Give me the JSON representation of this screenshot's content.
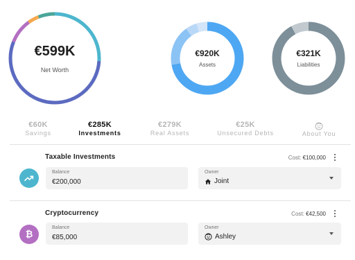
{
  "summary": {
    "net_worth": {
      "value": "€599K",
      "label": "Net Worth",
      "segments": [
        {
          "color": "#4db6ce",
          "fraction": 0.26
        },
        {
          "color": "#5c6bc0",
          "fraction": 0.55
        },
        {
          "color": "#b36fc2",
          "fraction": 0.09
        },
        {
          "color": "#f4a950",
          "fraction": 0.04
        },
        {
          "color": "#4aa59a",
          "fraction": 0.06
        }
      ]
    },
    "assets": {
      "value": "€920K",
      "label": "Assets",
      "segments": [
        {
          "color": "#4ea7f2",
          "fraction": 0.72
        },
        {
          "color": "#8cc3f5",
          "fraction": 0.18
        },
        {
          "color": "#b9d8f7",
          "fraction": 0.05
        },
        {
          "color": "#d3e5f8",
          "fraction": 0.05
        }
      ]
    },
    "liabilities": {
      "value": "€321K",
      "label": "Liabilities",
      "segments": [
        {
          "color": "#7d8f99",
          "fraction": 0.92
        },
        {
          "color": "#c2cacf",
          "fraction": 0.08
        }
      ]
    }
  },
  "tabs": [
    {
      "value": "€60K",
      "label": "Savings",
      "active": false
    },
    {
      "value": "€285K",
      "label": "Investments",
      "active": true
    },
    {
      "value": "€279K",
      "label": "Real Assets",
      "active": false
    },
    {
      "value": "€25K",
      "label": "Unsecured Debts",
      "active": false
    },
    {
      "value": "",
      "label": "About You",
      "icon": "face-icon",
      "active": false
    }
  ],
  "accounts": [
    {
      "title": "Taxable Investments",
      "cost_label": "Cost:",
      "cost_value": "€100,000",
      "icon": "investment-growth-icon",
      "icon_color": "#4db6ce",
      "balance_label": "Balance",
      "balance_value": "€200,000",
      "owner_label": "Owner",
      "owner_value": "Joint",
      "owner_icon": "home-icon"
    },
    {
      "title": "Cryptocurrency",
      "cost_label": "Cost:",
      "cost_value": "€42,500",
      "icon": "bitcoin-icon",
      "icon_color": "#b36fc2",
      "balance_label": "Balance",
      "balance_value": "€85,000",
      "owner_label": "Owner",
      "owner_value": "Ashley",
      "owner_icon": "face-icon"
    }
  ]
}
